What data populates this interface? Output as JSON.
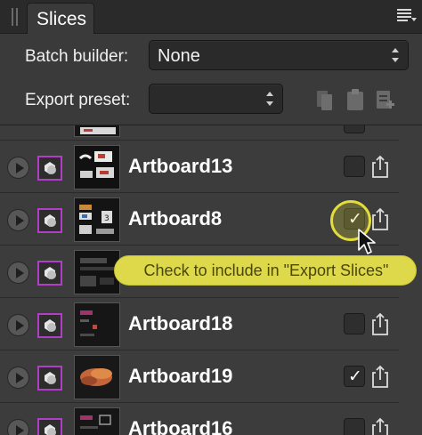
{
  "panel": {
    "tab_title": "Slices",
    "menu_icon": "panel-menu-icon"
  },
  "batch_builder": {
    "label": "Batch builder:",
    "value": "None"
  },
  "export_preset": {
    "label": "Export preset:",
    "value": "",
    "actions": [
      "copy-preset-icon",
      "paste-preset-icon",
      "add-preset-icon"
    ]
  },
  "rows": [
    {
      "name": "",
      "checked": false,
      "partial": true
    },
    {
      "name": "Artboard13",
      "checked": false
    },
    {
      "name": "Artboard8",
      "checked": true
    },
    {
      "name": "",
      "checked": false
    },
    {
      "name": "Artboard18",
      "checked": false
    },
    {
      "name": "Artboard19",
      "checked": true
    },
    {
      "name": "Artboard16",
      "checked": false
    }
  ],
  "tooltip": {
    "text": "Check to include in \"Export Slices\""
  },
  "colors": {
    "slice_icon_border": "#b13ec7",
    "tooltip_bg": "#ddd94a",
    "highlight": "#e3dd3a"
  }
}
